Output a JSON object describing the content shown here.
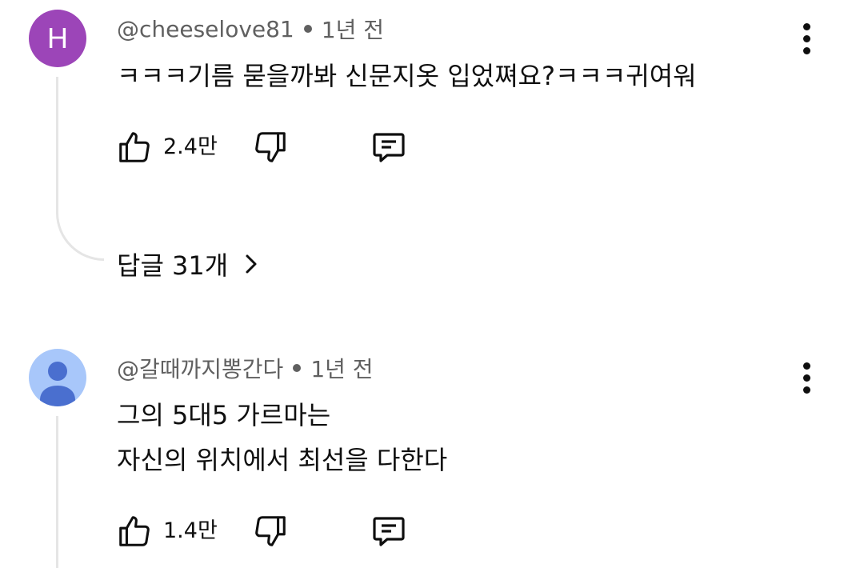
{
  "comments": [
    {
      "avatar_letter": "H",
      "avatar_color": "#9c45b8",
      "author": "@cheeselove81",
      "time": "1년 전",
      "lines": [
        "ㅋㅋㅋ기름 묻을까봐 신문지옷 입었쪄요?ㅋㅋㅋ귀여워"
      ],
      "like_count": "2.4만",
      "replies_label": "답글 31개"
    },
    {
      "avatar_icon": "person-icon",
      "avatar_color": "#a8c7fa",
      "author": "@갈때까지뽕간다",
      "time": "1년 전",
      "lines": [
        "그의 5대5 가르마는",
        "자신의 위치에서 최선을 다한다"
      ],
      "like_count": "1.4만"
    }
  ]
}
